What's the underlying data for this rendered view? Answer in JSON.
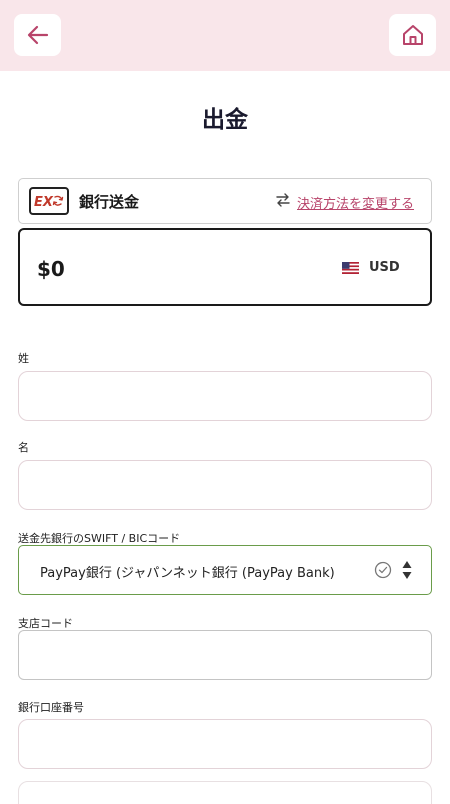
{
  "header": {
    "title": "出金",
    "back_icon": "arrow-left-icon",
    "home_icon": "home-icon"
  },
  "payment_method": {
    "logo_text": "EX",
    "name": "銀行送金",
    "change_label": "決済方法を変更する",
    "link_color": "#b8446a"
  },
  "amount": {
    "value": "$0",
    "currency": "USD"
  },
  "fields": {
    "last_name": {
      "label": "姓",
      "value": ""
    },
    "first_name": {
      "label": "名",
      "value": ""
    },
    "swift": {
      "label": "送金先銀行のSWIFT / BICコード",
      "value": "PayPay銀行 (ジャパンネット銀行 (PayPay Bank)"
    },
    "branch_code": {
      "label": "支店コード",
      "value": ""
    },
    "account_number": {
      "label": "銀行口座番号",
      "value": ""
    }
  },
  "colors": {
    "header_bg": "#f9e6ea",
    "accent": "#b8446a",
    "valid_border": "#6a9c4a"
  }
}
